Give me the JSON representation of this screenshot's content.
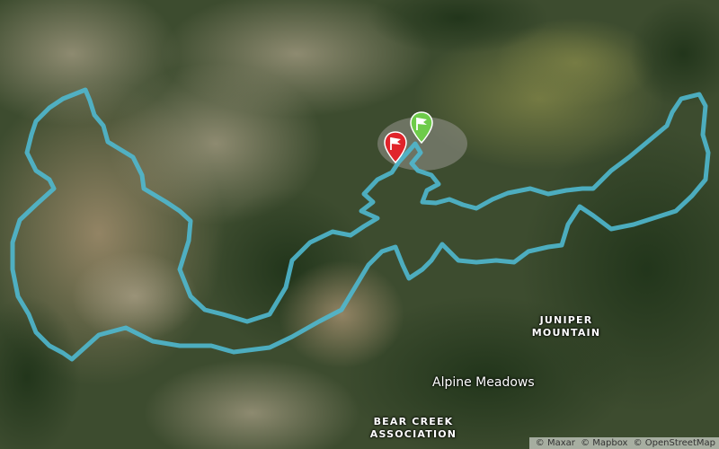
{
  "map": {
    "type": "satellite",
    "colors": {
      "route": "#4fb8cf",
      "start_marker": "#6ecb4a",
      "finish_marker": "#e0242b",
      "vegetation": "#2f4a26",
      "bare_ground": "#8b7a5e",
      "meadow": "#6f7d3f"
    },
    "labels": {
      "juniper_line1": "JUNIPER",
      "juniper_line2": "MOUNTAIN",
      "alpine": "Alpine Meadows",
      "bear_line1": "BEAR CREEK",
      "bear_line2": "ASSOCIATION"
    },
    "markers": {
      "start_icon": "flag-icon",
      "finish_icon": "flag-icon"
    },
    "attribution": {
      "maxar": "© Maxar",
      "mapbox": "© Mapbox",
      "osm": "© OpenStreetMap"
    }
  }
}
